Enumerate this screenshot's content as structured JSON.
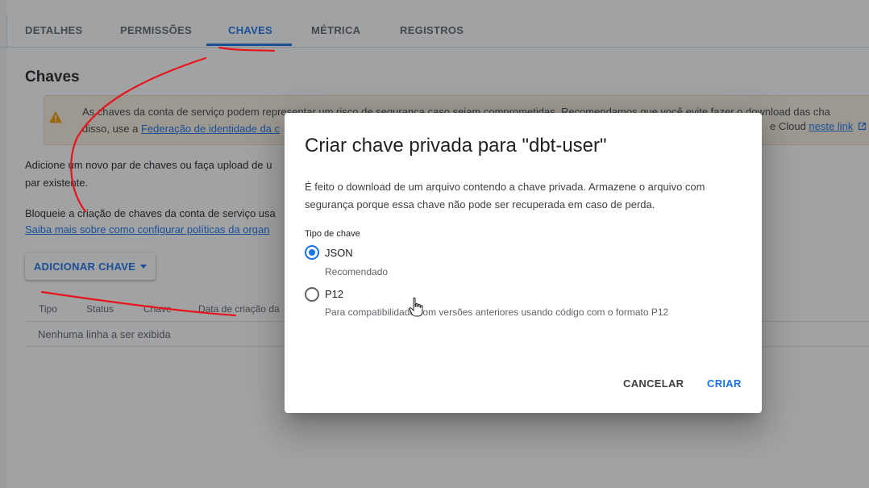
{
  "tabs": [
    "DETALHES",
    "PERMISSÕES",
    "CHAVES",
    "MÉTRICA",
    "REGISTROS"
  ],
  "active_tab": "CHAVES",
  "section_title": "Chaves",
  "warning": {
    "line1": "As chaves da conta de serviço podem representar um risco de segurança caso sejam comprometidas. Recomendamos que você evite fazer o download das cha",
    "line2_prefix": "disso, use a ",
    "line2_link": "Federação de identidade da c",
    "right_text": "e Cloud ",
    "right_link": "neste link"
  },
  "add_text": [
    "Adicione um novo par de chaves ou faça upload de u",
    "par existente."
  ],
  "block_text": "Bloqueie a criação de chaves da conta de serviço usa",
  "learn_link": "Saiba mais sobre como configurar políticas da organ",
  "add_key_button": "ADICIONAR CHAVE",
  "table": {
    "headers": [
      "Tipo",
      "Status",
      "Chave",
      "Data de criação da"
    ],
    "empty": "Nenhuma linha a ser exibida"
  },
  "dialog": {
    "title": "Criar chave privada para \"dbt-user\"",
    "description": "É feito o download de um arquivo contendo a chave privada. Armazene o arquivo com segurança porque essa chave não pode ser recuperada em caso de perda.",
    "key_type_label": "Tipo de chave",
    "options": [
      {
        "label": "JSON",
        "hint": "Recomendado",
        "selected": true
      },
      {
        "label": "P12",
        "hint": "Para compatibilidade com versões anteriores usando código com o formato P12",
        "selected": false
      }
    ],
    "cancel": "CANCELAR",
    "create": "CRIAR"
  },
  "colors": {
    "accent": "#1a73e8",
    "warning_icon": "#f29900",
    "annotation": "#e8141c"
  },
  "icons": {
    "warning": "warning-icon",
    "external": "external-link-icon",
    "cursor": "hand-pointer-icon"
  }
}
